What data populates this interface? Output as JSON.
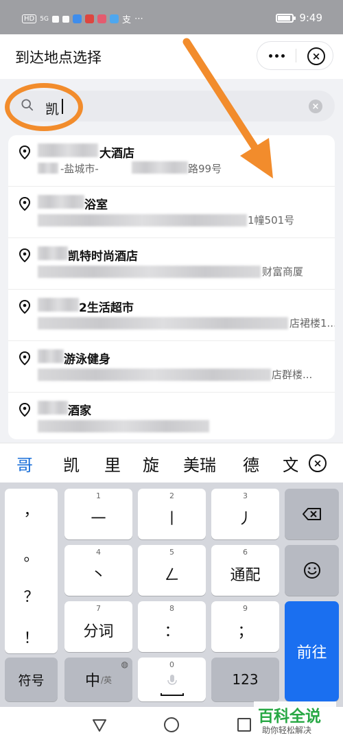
{
  "status_bar": {
    "time": "9:49",
    "hd": "HD",
    "net": "5G"
  },
  "header": {
    "title": "到达地点选择",
    "more_label": "•••",
    "close_label": "×"
  },
  "search": {
    "value": "凯",
    "clear_label": "×"
  },
  "results": [
    {
      "name": "大酒店",
      "address": "-盐城市-",
      "address_tail": "路99号"
    },
    {
      "name": "浴室",
      "address": "",
      "address_tail": "1幢501号"
    },
    {
      "name": "凯特时尚酒店",
      "address": "",
      "address_tail": "财富商厦"
    },
    {
      "name": "2生活超市",
      "address": "",
      "address_tail": "店裙楼1..."
    },
    {
      "name": "游泳健身",
      "address": "",
      "address_tail": "店群楼..."
    },
    {
      "name": "酒家",
      "address": "",
      "address_tail": ""
    }
  ],
  "candidates": [
    "哥",
    "凯",
    "里",
    "旋",
    "美瑞",
    "德",
    "文"
  ],
  "keyboard": {
    "punct": [
      "，",
      "。",
      "？",
      "！"
    ],
    "keys": [
      {
        "num": "1",
        "label": "一"
      },
      {
        "num": "2",
        "label": "丨"
      },
      {
        "num": "3",
        "label": "丿"
      },
      {
        "num": "4",
        "label": "丶"
      },
      {
        "num": "5",
        "label": "ㄥ"
      },
      {
        "num": "6",
        "label": "通配"
      },
      {
        "num": "7",
        "label": "分词"
      },
      {
        "num": "8",
        "label": "："
      },
      {
        "num": "9",
        "label": "；"
      }
    ],
    "symbol": "符号",
    "lang_main": "中",
    "lang_sub": "/英",
    "space_num": "0",
    "num_key": "123",
    "enter": "前往"
  },
  "watermark": {
    "title": "百科全说",
    "subtitle": "助你轻松解决"
  },
  "colors": {
    "accent": "#1a6ff0",
    "annotation": "#f28c2c",
    "watermark": "#27a844"
  }
}
